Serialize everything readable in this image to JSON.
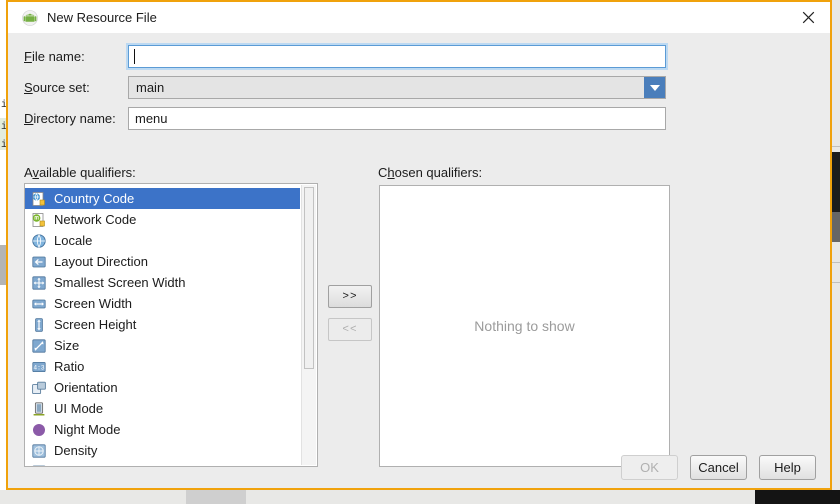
{
  "window": {
    "title": "New Resource File",
    "icon": "android-robot-icon",
    "close_label": "✕",
    "border_color": "#f0a20c"
  },
  "form": {
    "file_name": {
      "label": "File name:",
      "label_mnemonic": "F",
      "value": "",
      "focused": true
    },
    "source_set": {
      "label": "Source set:",
      "label_mnemonic": "S",
      "value": "main",
      "options": [
        "main"
      ]
    },
    "directory_name": {
      "label": "Directory name:",
      "label_mnemonic": "D",
      "value": "menu"
    }
  },
  "available": {
    "label": "Available qualifiers:",
    "label_mnemonic": "v",
    "selected_index": 0,
    "items": [
      {
        "label": "Country Code",
        "icon": "country-code-icon"
      },
      {
        "label": "Network Code",
        "icon": "network-code-icon"
      },
      {
        "label": "Locale",
        "icon": "globe-icon"
      },
      {
        "label": "Layout Direction",
        "icon": "layout-direction-icon"
      },
      {
        "label": "Smallest Screen Width",
        "icon": "smallest-screen-width-icon"
      },
      {
        "label": "Screen Width",
        "icon": "screen-width-icon"
      },
      {
        "label": "Screen Height",
        "icon": "screen-height-icon"
      },
      {
        "label": "Size",
        "icon": "size-icon"
      },
      {
        "label": "Ratio",
        "icon": "ratio-icon"
      },
      {
        "label": "Orientation",
        "icon": "orientation-icon"
      },
      {
        "label": "UI Mode",
        "icon": "ui-mode-icon"
      },
      {
        "label": "Night Mode",
        "icon": "night-mode-icon"
      },
      {
        "label": "Density",
        "icon": "density-icon"
      },
      {
        "label": "",
        "icon": "partial-icon"
      }
    ]
  },
  "transfer": {
    "add_label": ">>",
    "add_enabled": true,
    "remove_label": "<<",
    "remove_enabled": false
  },
  "chosen": {
    "label": "Chosen qualifiers:",
    "label_mnemonic": "h",
    "empty_text": "Nothing to show",
    "items": []
  },
  "footer": {
    "ok_label": "OK",
    "ok_enabled": false,
    "cancel_label": "Cancel",
    "cancel_enabled": true,
    "help_label": "Help",
    "help_enabled": true
  },
  "colors": {
    "selection_blue": "#3c73c8",
    "combo_arrow_blue": "#4a7ebb",
    "focus_blue": "#5b9bd5",
    "dialog_bg": "#ececec",
    "placeholder_gray": "#9b9b9b"
  }
}
